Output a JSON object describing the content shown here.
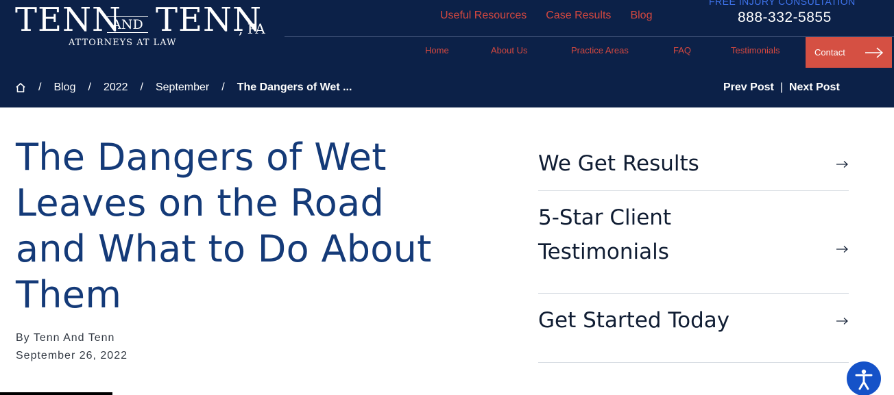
{
  "logo": {
    "word1": "TENN",
    "and": "AND",
    "word2": "TENN",
    "suffix": ", PA",
    "tagline": "ATTORNEYS AT LAW"
  },
  "top_links": [
    "Useful Resources",
    "Case Results",
    "Blog"
  ],
  "consultation": {
    "label": "FREE INJURY CONSULTATION",
    "phone": "888-332-5855"
  },
  "main_nav": [
    "Home",
    "About Us",
    "Practice Areas",
    "FAQ",
    "Testimonials"
  ],
  "contact_label": "Contact",
  "breadcrumb": {
    "items": [
      "Blog",
      "2022",
      "September"
    ],
    "current": "The Dangers of Wet ...",
    "separator": "/"
  },
  "post_nav": {
    "prev": "Prev Post",
    "separator": "|",
    "next": "Next Post"
  },
  "article": {
    "title": "The Dangers of Wet Leaves on the Road and What to Do About Them",
    "author_line": "By Tenn And Tenn",
    "date": "September 26, 2022"
  },
  "side_links": [
    {
      "label": "We Get Results"
    },
    {
      "label": "5-Star Client Testimonials"
    },
    {
      "label": "Get Started Today"
    }
  ],
  "colors": {
    "header_bg": "#0c2148",
    "nav_link": "#d5483f",
    "contact_bg": "#d55043",
    "title": "#143a78",
    "consult_label": "#3f74ee",
    "accessibility": "#1552c8"
  },
  "icons": {
    "breadcrumb_home": "home-icon",
    "contact_arrow": "arrow-right-icon",
    "side_link_arrow": "arrow-right-icon",
    "accessibility": "accessibility-icon"
  }
}
